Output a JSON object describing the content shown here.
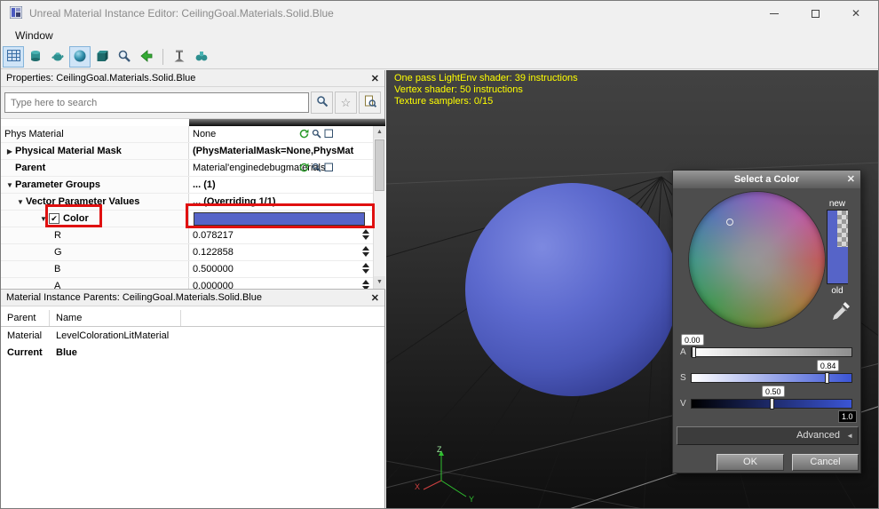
{
  "window": {
    "title": "Unreal Material Instance Editor: CeilingGoal.Materials.Solid.Blue",
    "menu_items": [
      {
        "label": "Window"
      }
    ],
    "controls": {
      "close": "✕"
    }
  },
  "glyphs": {
    "check": "✔",
    "expander_open": "▼",
    "expander_closed": "▶",
    "scroll_up": "▲",
    "scroll_down": "▼",
    "advanced_arrow": "◄",
    "star": "☆"
  },
  "toolbar": {
    "buttons": [
      {
        "name": "background-toggle-button",
        "icon": "grid",
        "pressed": true
      },
      {
        "name": "cylinder-preview-button",
        "icon": "cylinder",
        "pressed": false
      },
      {
        "name": "teapot-preview-button",
        "icon": "teapot",
        "pressed": false
      },
      {
        "name": "sphere-preview-button",
        "icon": "sphere",
        "pressed": true
      },
      {
        "name": "cube-preview-button",
        "icon": "cube",
        "pressed": false
      },
      {
        "name": "realtime-preview-button",
        "icon": "magnifier",
        "pressed": false
      },
      {
        "name": "sync-generic-browser-button",
        "icon": "green-arrow",
        "pressed": false
      },
      {
        "name": "separator"
      },
      {
        "name": "use-selected-mesh-button",
        "icon": "stand",
        "pressed": false
      },
      {
        "name": "show-all-parameters-button",
        "icon": "scope",
        "pressed": false
      }
    ]
  },
  "properties": {
    "title": "Properties: CeilingGoal.Materials.Solid.Blue",
    "search_placeholder": "Type here to search",
    "rows": [
      {
        "label": "Phys Material",
        "value": "None",
        "indent": 0,
        "value_icons": true
      },
      {
        "label": "Physical Material Mask",
        "value": "(PhysMaterialMask=None,PhysMat",
        "indent": 0,
        "expand": "closed",
        "bold_label": true,
        "bold_value": true
      },
      {
        "label": "Parent",
        "value": "Material'enginedebugmaterials.",
        "indent": 1,
        "bold_label": true,
        "value_icons": true
      },
      {
        "label": "Parameter Groups",
        "value": "... (1)",
        "indent": 0,
        "expand": "open",
        "bold_label": true,
        "bold_value": true
      },
      {
        "label": "Vector Parameter Values",
        "value": "... (Overriding 1/1)",
        "indent": 1,
        "expand": "open",
        "bold_label": true,
        "bold_value": true
      },
      {
        "label": "Color",
        "indent": 2,
        "expand": "open",
        "checkbox": true,
        "checked": true,
        "swatch": "#5664c8",
        "bold_label": true
      },
      {
        "label": "R",
        "value": "0.078217",
        "indent": 3,
        "spinner": true
      },
      {
        "label": "G",
        "value": "0.122858",
        "indent": 3,
        "spinner": true
      },
      {
        "label": "B",
        "value": "0.500000",
        "indent": 3,
        "spinner": true
      },
      {
        "label": "A",
        "value": "0.000000",
        "indent": 3,
        "spinner": true
      }
    ]
  },
  "parents_panel": {
    "title": "Material Instance Parents: CeilingGoal.Materials.Solid.Blue",
    "columns": [
      "Parent",
      "Name"
    ],
    "rows": [
      {
        "parent": "Material",
        "name": "LevelColorationLitMaterial",
        "bold": false
      },
      {
        "parent": "Current",
        "name": "Blue",
        "bold": true
      }
    ]
  },
  "viewport": {
    "stats": [
      "One pass LightEnv shader: 39 instructions",
      "Vertex shader: 50 instructions",
      "Texture samplers: 0/15"
    ],
    "stats_color": "#ffff00",
    "axis_labels": {
      "x": "X",
      "y": "Y",
      "z": "Z"
    },
    "sphere_color": "#5664c8"
  },
  "color_dialog": {
    "title": "Select a Color",
    "close": "✕",
    "new_label": "new",
    "old_label": "old",
    "current_color": "#5664c8",
    "sliders": [
      {
        "label": "A",
        "value": "0.00",
        "pos": 0.0,
        "track": "alpha"
      },
      {
        "label": "S",
        "value": "0.84",
        "pos": 0.84,
        "track": "sat"
      },
      {
        "label": "V",
        "value": "0.50",
        "pos": 0.5,
        "track": "val"
      }
    ],
    "brightness_value": "1.0",
    "advanced_label": "Advanced",
    "ok_label": "OK",
    "cancel_label": "Cancel"
  }
}
